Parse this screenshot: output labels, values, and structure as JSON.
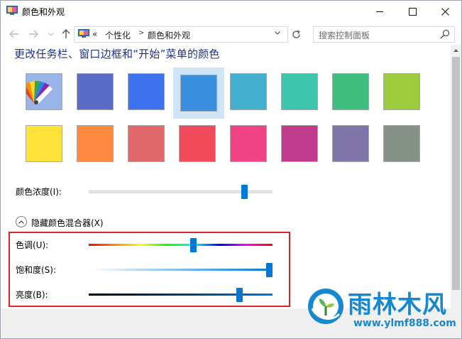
{
  "window": {
    "title": "颜色和外观",
    "controls": {
      "minimize": "minimize",
      "maximize": "maximize",
      "close": "close"
    }
  },
  "nav": {
    "back_icon": "arrow-left-icon",
    "forward_icon": "arrow-right-icon",
    "recent_icon": "chevron-down-icon",
    "up_icon": "arrow-up-icon",
    "breadcrumb": {
      "overflow": "«",
      "items": [
        "个性化",
        "颜色和外观"
      ]
    },
    "refresh_icon": "refresh-icon",
    "search": {
      "placeholder": "搜索控制面板",
      "icon": "search-icon"
    }
  },
  "main": {
    "heading": "更改任务栏、窗口边框和“开始”菜单的颜色",
    "swatches": {
      "row1": [
        "auto",
        "#5b6bc8",
        "#3f72ee",
        "#3b8fe0",
        "#43b0cf",
        "#3dc6ad",
        "#3dbe7c",
        "#9ccb3d"
      ],
      "row2": [
        "#ffe23a",
        "#ff8a3f",
        "#e0676a",
        "#f04a5b",
        "#f04385",
        "#c23c8d",
        "#7f75a8",
        "#869288"
      ],
      "selected_index": 3
    },
    "intensity": {
      "label": "颜色浓度(I):",
      "value": 0.86
    },
    "mixer_toggle": {
      "label": "隐藏颜色混合器(X)",
      "icon": "chevron-up-icon"
    },
    "mixer": {
      "hue": {
        "label": "色调(U):",
        "value": 0.57
      },
      "saturation": {
        "label": "饱和度(S):",
        "value": 1.0
      },
      "brightness": {
        "label": "亮度(B):",
        "value": 0.83
      }
    }
  },
  "watermark": {
    "title": "雨林木风",
    "url": "www.ylmf888.com",
    "logo": "ylmf-logo-icon"
  },
  "colors": {
    "accent": "#0078d7",
    "heading": "#1e3287",
    "highlight_border": "#d9262b",
    "watermark": "#1588d0"
  }
}
